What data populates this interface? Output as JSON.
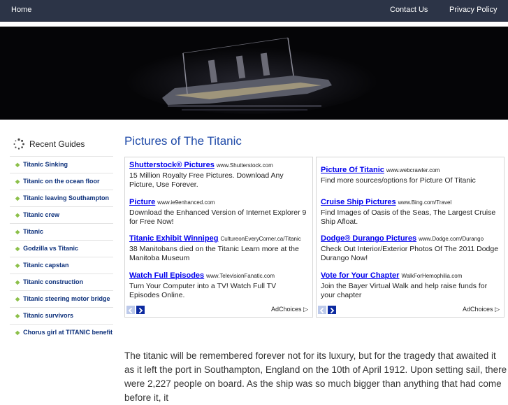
{
  "nav": {
    "home": "Home",
    "contact": "Contact Us",
    "privacy": "Privacy Policy"
  },
  "sidebar": {
    "title": "Recent Guides",
    "items": [
      {
        "label": "Titanic Sinking"
      },
      {
        "label": "Titanic on the ocean floor"
      },
      {
        "label": "Titanic leaving Southampton"
      },
      {
        "label": "Titanic crew"
      },
      {
        "label": "Titanic"
      },
      {
        "label": "Godzilla vs Titanic"
      },
      {
        "label": "Titanic capstan"
      },
      {
        "label": "Titanic construction"
      },
      {
        "label": "Titanic steering motor bridge"
      },
      {
        "label": "Titanic survivors"
      },
      {
        "label": "Chorus girl at TITANIC benefit"
      }
    ]
  },
  "main": {
    "title": "Pictures of The Titanic",
    "body": "The titanic will be remembered forever not for its luxury, but for the tragedy that awaited it as it left the port in Southampton, England on the 10th of April 1912. Upon setting sail, there were 2,227 people on board. As the ship was so much bigger than anything that had come before it, it"
  },
  "ads_left": {
    "adchoices": "AdChoices",
    "items": [
      {
        "title": "Shutterstock® Pictures",
        "url": "www.Shutterstock.com",
        "desc": "15 Million Royalty Free Pictures. Download Any Picture, Use Forever."
      },
      {
        "title": "Picture",
        "url": "www.ie9enhanced.com",
        "desc": "Download the Enhanced Version of Internet Explorer 9 for Free Now!"
      },
      {
        "title": "Titanic Exhibit Winnipeg",
        "url": "CultureonEveryCorner.ca/Titanic",
        "desc": "38 Manitobans died on the Titanic Learn more at the Manitoba Museum"
      },
      {
        "title": "Watch Full Episodes",
        "url": "www.TelevisionFanatic.com",
        "desc": "Turn Your Computer into a TV! Watch Full TV Episodes Online."
      }
    ]
  },
  "ads_right": {
    "adchoices": "AdChoices",
    "items": [
      {
        "title": "Picture Of Titanic",
        "url": "www.webcrawler.com",
        "desc": "Find more sources/options for Picture Of Titanic"
      },
      {
        "title": "Cruise Ship Pictures",
        "url": "www.Bing.com/Travel",
        "desc": "Find Images of Oasis of the Seas, The Largest Cruise Ship Afloat."
      },
      {
        "title": "Dodge® Durango Pictures",
        "url": "www.Dodge.com/Durango",
        "desc": "Check Out Interior/Exterior Photos Of The 2011 Dodge Durango Now!"
      },
      {
        "title": "Vote for Your Chapter",
        "url": "WalkForHemophilia.com",
        "desc": "Join the Bayer Virtual Walk and help raise funds for your chapter"
      }
    ]
  }
}
